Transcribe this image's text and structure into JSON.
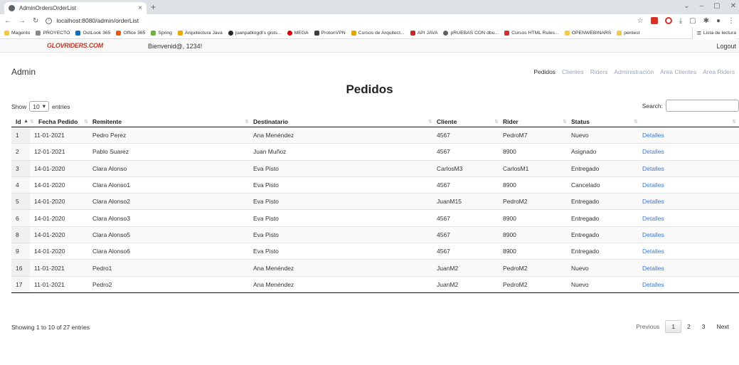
{
  "browser": {
    "tab_title": "AdminOrdersOrderList",
    "url": "localhost:8080/admin/orderList",
    "bookmarks": [
      "Magento",
      "PROYECTO",
      "OutLook 365",
      "Office 365",
      "Spring",
      "Arquitectura Java",
      "juanpablogdl's gists...",
      "MEGA",
      "ProtonVPN",
      "Cursos de Arquitect...",
      "API JAVA",
      "pRUEBAS CON dbu...",
      "Cursos HTML Rules...",
      "OPENWEBINARS",
      "pentest"
    ],
    "reading_list": "Lista de lectura"
  },
  "app": {
    "logo": "GLOVRIDERS.COM",
    "welcome": "Bienvenid@, 1234!",
    "logout": "Logout",
    "brand": "Admin",
    "nav": [
      {
        "label": "Pedidos",
        "active": true
      },
      {
        "label": "Clientes",
        "active": false
      },
      {
        "label": "Riders",
        "active": false
      },
      {
        "label": "Administración",
        "active": false
      },
      {
        "label": "Area Clientes",
        "active": false
      },
      {
        "label": "Area Riders",
        "active": false
      }
    ],
    "page_title": "Pedidos"
  },
  "table": {
    "show_label": "Show",
    "entries_value": "10",
    "entries_label": "entries",
    "search_label": "Search:",
    "headers": [
      "Id",
      "Fecha Pedido",
      "Remitente",
      "Destinatario",
      "Cliente",
      "Rider",
      "Status",
      ""
    ],
    "rows": [
      [
        "1",
        "11-01-2021",
        "Pedro Perez",
        "Ana Menéndez",
        "4567",
        "PedroM7",
        "Nuevo",
        "Detalles"
      ],
      [
        "2",
        "12-01-2021",
        "Pablo Suarez",
        "Juan Muñoz",
        "4567",
        "8900",
        "Asignado",
        "Detalles"
      ],
      [
        "3",
        "14-01-2020",
        "Clara Alonso",
        "Eva Pisto",
        "CarlosM3",
        "CarlosM1",
        "Entregado",
        "Detalles"
      ],
      [
        "4",
        "14-01-2020",
        "Clara Alonso1",
        "Eva Pisto",
        "4567",
        "8900",
        "Cancelado",
        "Detalles"
      ],
      [
        "5",
        "14-01-2020",
        "Clara Alonso2",
        "Eva Pisto",
        "JuanM15",
        "PedroM2",
        "Entregado",
        "Detalles"
      ],
      [
        "6",
        "14-01-2020",
        "Clara Alonso3",
        "Eva Pisto",
        "4567",
        "8900",
        "Entregado",
        "Detalles"
      ],
      [
        "8",
        "14-01-2020",
        "Clara Alonso5",
        "Eva Pisto",
        "4567",
        "8900",
        "Entregado",
        "Detalles"
      ],
      [
        "9",
        "14-01-2020",
        "Clara Alonso6",
        "Eva Pisto",
        "4567",
        "8900",
        "Entregado",
        "Detalles"
      ],
      [
        "16",
        "11-01-2021",
        "Pedro1",
        "Ana Menéndez",
        "JuanM2",
        "PedroM2",
        "Nuevo",
        "Detalles"
      ],
      [
        "17",
        "11-01-2021",
        "Pedro2",
        "Ana Menéndez",
        "JuanM2",
        "PedroM2",
        "Nuevo",
        "Detalles"
      ]
    ],
    "info": "Showing 1 to 10 of 27 entries",
    "pagination": {
      "previous": "Previous",
      "pages": [
        "1",
        "2",
        "3"
      ],
      "current": "1",
      "next": "Next"
    }
  },
  "colors": {
    "link": "#3478d4",
    "nav_inactive": "#9aa7b8",
    "logo": "#c0392b"
  }
}
